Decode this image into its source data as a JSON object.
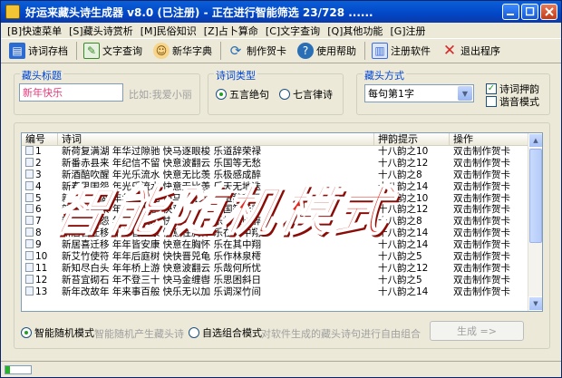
{
  "window": {
    "title": "好运来藏头诗生成器 v8.0 (已注册) - 正在进行智能筛选 23/728 ......"
  },
  "menu": [
    "[B]快速菜单",
    "[S]藏头诗赏析",
    "[M]民俗知识",
    "[Z]占卜算命",
    "[C]文字查询",
    "[Q]其他功能",
    "[G]注册"
  ],
  "toolbar": {
    "buttons": [
      {
        "label": "诗词存档",
        "icon": "save-icon",
        "color": "#2e6bd1"
      },
      {
        "label": "文字查询",
        "icon": "search-icon",
        "color": "#3a8a2a"
      },
      {
        "label": "新华字典",
        "icon": "dictionary-icon",
        "color": "#c9851a"
      },
      {
        "label": "制作贺卡",
        "icon": "card-icon",
        "color": "#2a6fb6"
      },
      {
        "label": "使用帮助",
        "icon": "help-icon",
        "color": "#2a6fb6"
      },
      {
        "label": "注册软件",
        "icon": "register-icon",
        "color": "#3d6ed8"
      },
      {
        "label": "退出程序",
        "icon": "exit-icon",
        "color": "#d62b2b"
      }
    ]
  },
  "form": {
    "head_title": {
      "label": "藏头标题",
      "value": "新年快乐",
      "hint": "比如:我爱小丽"
    },
    "poem_type": {
      "label": "诗词类型",
      "options": [
        "五言绝句",
        "七言律诗"
      ],
      "selected": 0
    },
    "head_mode": {
      "label": "藏头方式",
      "value": "每句第1字"
    },
    "rhyme_check": {
      "label": "诗词押韵",
      "checked": true
    },
    "homophone_check": {
      "label": "谐音模式",
      "checked": false
    }
  },
  "table": {
    "headers": [
      "编号",
      "诗词",
      "押韵提示",
      "操作"
    ],
    "rows": [
      {
        "num": "1",
        "poem": "新荷复满湖  年华过隙驰  快马逐眼梭  乐道辞荣禄",
        "rhyme": "十八韵之10",
        "action": "双击制作贺卡"
      },
      {
        "num": "2",
        "poem": "新番赤县来  年纪信不留  快意波翻云  乐国等无愁",
        "rhyme": "十八韵之12",
        "action": "双击制作贺卡"
      },
      {
        "num": "3",
        "poem": "新酒醅吹醒  年光乐流水  快意无比羡  乐极感成醉",
        "rhyme": "十八韵之8",
        "action": "双击制作贺卡"
      },
      {
        "num": "4",
        "poem": "新春思围怨  年光乐流水  快意无比羡  乐天无地迭",
        "rhyme": "十八韵之14",
        "action": "双击制作贺卡"
      },
      {
        "num": "5",
        "poem": "新荷复满湖  年华过隙驰  快马逐眼梭  乐道辞荣问",
        "rhyme": "十八韵之10",
        "action": "双击制作贺卡"
      },
      {
        "num": "6",
        "poem": "新番赤县来  年纪信不留  快意惜过秋  乐国等无愁",
        "rhyme": "十八韵之12",
        "action": "双击制作贺卡"
      },
      {
        "num": "7",
        "poem": "新春思围怨  年光乐流水  快意无比羡  乐极感成醉",
        "rhyme": "十八韵之8",
        "action": "双击制作贺卡"
      },
      {
        "num": "8",
        "poem": "新居喜迁移  年年皆安康  快意在胸怀  乐在其中翔",
        "rhyme": "十八韵之14",
        "action": "双击制作贺卡"
      },
      {
        "num": "9",
        "poem": "新居喜迁移  年年皆安康  快意在胸怀  乐在其中翔",
        "rhyme": "十八韵之14",
        "action": "双击制作贺卡"
      },
      {
        "num": "10",
        "poem": "新艾竹使符  年年后庭树  快快晋兕龟  乐作林泉樗",
        "rhyme": "十八韵之5",
        "action": "双击制作贺卡"
      },
      {
        "num": "11",
        "poem": "新知尽白头  年年桥上游  快意波翻云  乐哉何所忧",
        "rhyme": "十八韵之12",
        "action": "双击制作贺卡"
      },
      {
        "num": "12",
        "poem": "新苔宜砌石  年不登三十  快马金缠辔  乐思困斜日",
        "rhyme": "十八韵之5",
        "action": "双击制作贺卡"
      },
      {
        "num": "13",
        "poem": "新年改故年  年来事百般  快乐无以加  乐调深竹间",
        "rhyme": "十八韵之14",
        "action": "双击制作贺卡"
      }
    ]
  },
  "watermark": [
    "智",
    "能",
    "随",
    "机",
    "模",
    "式"
  ],
  "mode": {
    "smart": {
      "label": "智能随机模式",
      "desc": "智能随机产生藏头诗",
      "selected": true
    },
    "custom": {
      "label": "自选组合模式",
      "desc": "对软件生成的藏头诗句进行自由组合",
      "selected": false
    },
    "generate_label": "生成 =>"
  },
  "status": {
    "progress": 0.2
  }
}
